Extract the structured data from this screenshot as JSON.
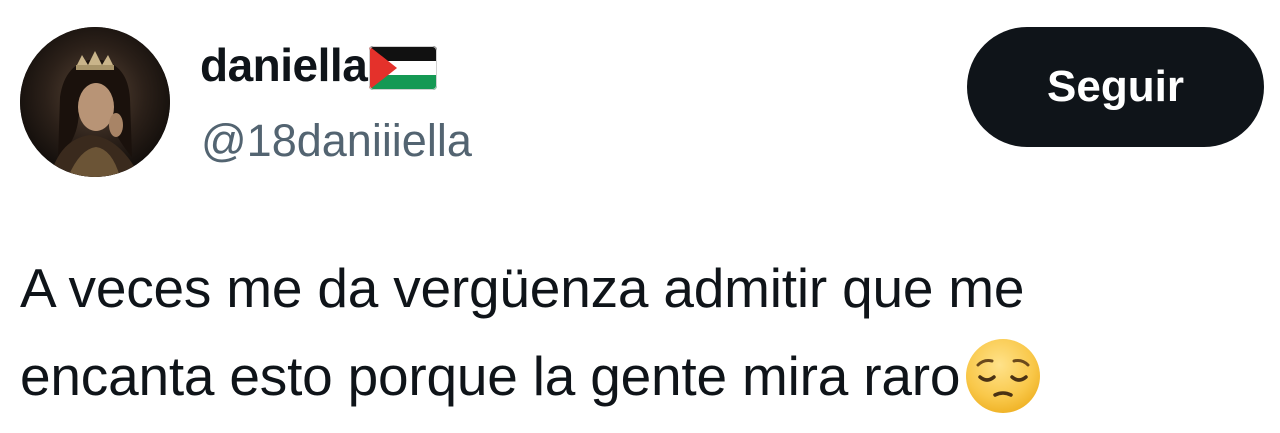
{
  "user": {
    "display_name": "daniella",
    "handle": "@18daniiiella",
    "name_badge_icon": "palestine-flag-icon",
    "avatar_icon": "profile-photo-woman-with-crown"
  },
  "actions": {
    "follow_label": "Seguir"
  },
  "tweet": {
    "line1": "A veces me da vergüenza admitir que me",
    "line2": "encanta esto porque la gente mira raro",
    "trailing_emoji": "pensive-face-icon"
  },
  "colors": {
    "text": "#0f1419",
    "secondary_text": "#536471",
    "button_bg": "#0f1419",
    "button_text": "#ffffff"
  }
}
